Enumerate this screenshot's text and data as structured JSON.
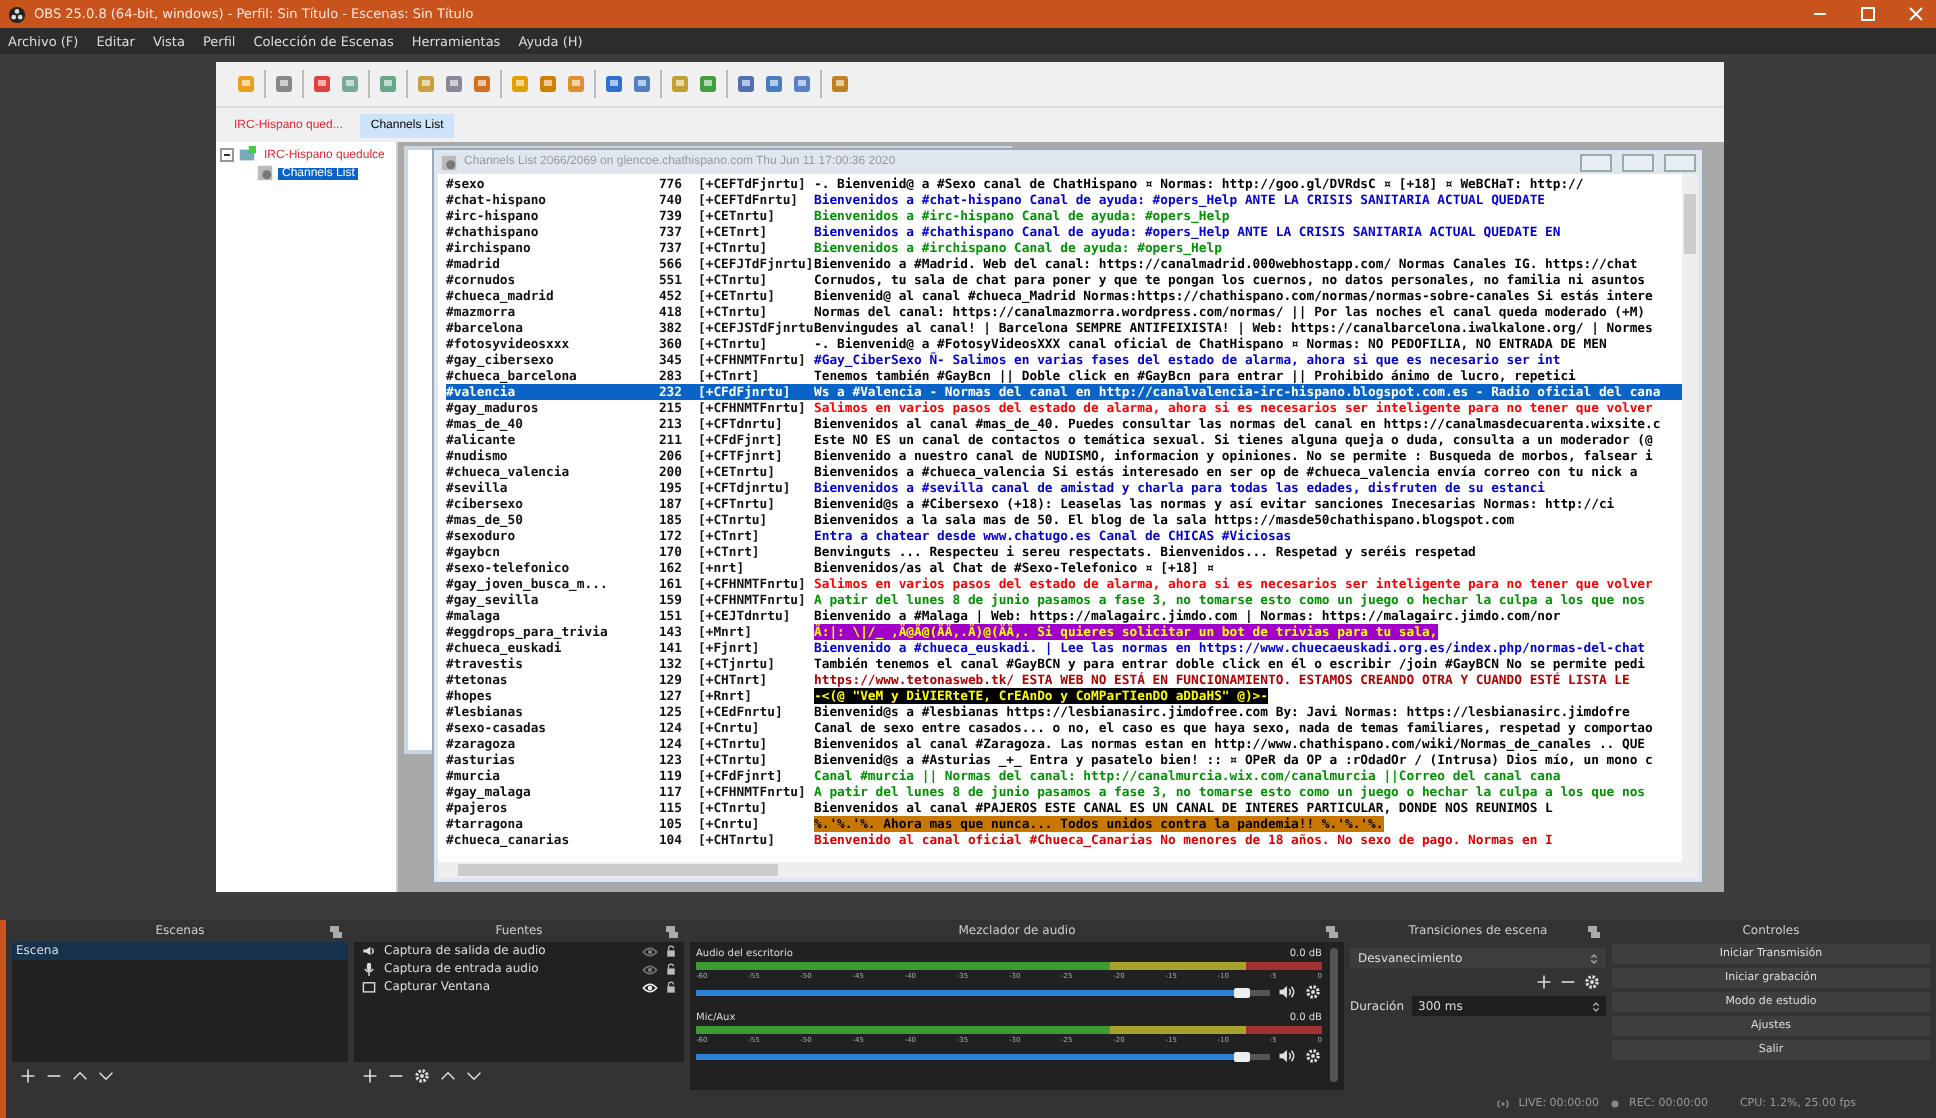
{
  "window": {
    "title": "OBS 25.0.8 (64-bit, windows) - Perfil: Sin Título - Escenas: Sin Título"
  },
  "menu": [
    "Archivo (F)",
    "Editar",
    "Vista",
    "Perfil",
    "Colección de Escenas",
    "Herramientas",
    "Ayuda (H)"
  ],
  "capture": {
    "tabs": [
      {
        "label": "IRC-Hispano qued...",
        "selected": false,
        "color": "#e8262d"
      },
      {
        "label": "Channels List",
        "selected": true,
        "color": "#000000"
      }
    ],
    "tree": [
      {
        "label": "IRC-Hispano quedulce",
        "expanded": true,
        "selected": false,
        "children": [
          {
            "label": "Channels List",
            "selected": true
          }
        ]
      }
    ],
    "channels_window": {
      "title": "Channels List 2066/2069 on glencoe.chathispano.com Thu Jun 11 17:00:36 2020",
      "rows": [
        {
          "name": "#sexo",
          "users": "776",
          "modes": "[+CEFTdFjnrtu]",
          "topic": "-. Bienvenid@ a #Sexo canal de ChatHispano ¤ Normas: http://goo.gl/DVRdsC ¤ [+18] ¤ WeBCHaT: http://",
          "color": "#000000",
          "highlighted": false,
          "selected": false
        },
        {
          "name": "#chat-hispano",
          "users": "740",
          "modes": "[+CEFTdFnrtu]",
          "topic": "Bienvenidos a #chat-hispano Canal de ayuda: #opers_Help ANTE LA CRISIS SANITARIA ACTUAL QUEDATE",
          "color": "#0000d0",
          "highlighted": false,
          "selected": false
        },
        {
          "name": "#irc-hispano",
          "users": "739",
          "modes": "[+CETnrtu]",
          "topic": "Bienvenidos a #irc-hispano Canal de ayuda: #opers_Help",
          "color": "#009300",
          "highlighted": false,
          "selected": false
        },
        {
          "name": "#chathispano",
          "users": "737",
          "modes": "[+CETnrt]",
          "topic": "Bienvenidos a #chathispano Canal de ayuda: #opers_Help ANTE LA CRISIS SANITARIA ACTUAL QUEDATE EN",
          "color": "#0000d0",
          "highlighted": false,
          "selected": false
        },
        {
          "name": "#irchispano",
          "users": "737",
          "modes": "[+CTnrtu]",
          "topic": "Bienvenidos a #irchispano Canal de ayuda: #opers_Help",
          "color": "#009300",
          "highlighted": false,
          "selected": false
        },
        {
          "name": "#madrid",
          "users": "566",
          "modes": "[+CEFJTdFjnrtu]",
          "topic": "Bienvenido a #Madrid. Web del canal: https://canalmadrid.000webhostapp.com/ Normas Canales IG. https://chat",
          "color": "#000000",
          "highlighted": false,
          "selected": false
        },
        {
          "name": "#cornudos",
          "users": "551",
          "modes": "[+CTnrtu]",
          "topic": "Cornudos, tu sala de chat para poner y que te pongan los cuernos, no datos personales, no familia ni asuntos",
          "color": "#000000",
          "highlighted": false,
          "selected": false
        },
        {
          "name": "#chueca_madrid",
          "users": "452",
          "modes": "[+CETnrtu]",
          "topic": "Bienvenid@ al canal #chueca_Madrid Normas:https://chathispano.com/normas/normas-sobre-canales Si estás intere",
          "color": "#000000",
          "highlighted": false,
          "selected": false
        },
        {
          "name": "#mazmorra",
          "users": "418",
          "modes": "[+CTnrtu]",
          "topic": "Normas del canal: https://canalmazmorra.wordpress.com/normas/ || Por las noches el canal queda moderado (+M)",
          "color": "#000000",
          "highlighted": false,
          "selected": false
        },
        {
          "name": "#barcelona",
          "users": "382",
          "modes": "[+CEFJSTdFjnrtu",
          "topic": "Benvingudes al canal! | Barcelona SEMPRE ANTIFEIXISTA! | Web: https://canalbarcelona.iwalkalone.org/ | Normes",
          "color": "#000000",
          "highlighted": false,
          "selected": false
        },
        {
          "name": "#fotosyvideosxxx",
          "users": "360",
          "modes": "[+CTnrtu]",
          "topic": "-. Bienvenid@ a #FotosyVideosXXX canal oficial de ChatHispano ¤ Normas: NO PEDOFILIA, NO ENTRADA DE MEN",
          "color": "#000000",
          "highlighted": false,
          "selected": false
        },
        {
          "name": "#gay_cibersexo",
          "users": "345",
          "modes": "[+CFHNMTFnrtu]",
          "topic": "#Gay_CiberSexo Ñ- Salimos en varias fases del estado de alarma, ahora si que es necesario ser int",
          "color": "#0000d0",
          "highlighted": false,
          "selected": false
        },
        {
          "name": "#chueca_barcelona",
          "users": "283",
          "modes": "[+CTnrt]",
          "topic": "Tenemos también #GayBcn || Doble click en #GayBcn para entrar || Prohibido ánimo de lucro, repetici",
          "color": "#000000",
          "highlighted": false,
          "selected": false
        },
        {
          "name": "#valencia",
          "users": "232",
          "modes": "[+CFdFjnrtu]",
          "topic": "Ws a #Valencia - Normas del canal en http://canalvalencia-irc-hispano.blogspot.com.es - Radio oficial del cana",
          "highlighted": false,
          "selected": true
        },
        {
          "name": "#gay_maduros",
          "users": "215",
          "modes": "[+CFHNMTFnrtu]",
          "topic": "Salimos en varios pasos del estado de alarma, ahora si es necesarios ser inteligente para no tener que volver",
          "color": "#ff0000",
          "highlighted": false,
          "selected": false
        },
        {
          "name": "#mas_de_40",
          "users": "213",
          "modes": "[+CFTdnrtu]",
          "topic": "Bienvenidos al canal #mas_de_40. Puedes consultar las normas del canal en https://canalmasdecuarenta.wixsite.c",
          "color": "#000000",
          "highlighted": false,
          "selected": false
        },
        {
          "name": "#alicante",
          "users": "211",
          "modes": "[+CFdFjnrt]",
          "topic": "Este NO ES un canal de contactos o temática sexual. Si tienes alguna queja o duda, consulta a un moderador (@",
          "color": "#000000",
          "highlighted": false,
          "selected": false
        },
        {
          "name": "#nudismo",
          "users": "206",
          "modes": "[+CFTFjnrt]",
          "topic": "Bienvenido a nuestro canal de NUDISMO, informacion y opiniones. No se permite : Busqueda de morbos, falsear i",
          "color": "#000000",
          "highlighted": false,
          "selected": false
        },
        {
          "name": "#chueca_valencia",
          "users": "200",
          "modes": "[+CETnrtu]",
          "topic": "Bienvenidos a #chueca_valencia Si estás interesado en ser op de #chueca_valencia envía correo con tu nick a",
          "color": "#000000",
          "highlighted": false,
          "selected": false
        },
        {
          "name": "#sevilla",
          "users": "195",
          "modes": "[+CFTdjnrtu]",
          "topic": "Bienvenidos a #sevilla canal de amistad y charla para todas las edades, disfruten de su estanci",
          "color": "#0000d0",
          "highlighted": false,
          "selected": false
        },
        {
          "name": "#cibersexo",
          "users": "187",
          "modes": "[+CFTnrtu]",
          "topic": "Bienvenid@s a #Cibersexo (+18): Leaselas las normas y así evitar sanciones Inecesarias Normas: http://ci",
          "color": "#000000",
          "highlighted": false,
          "selected": false
        },
        {
          "name": "#mas_de_50",
          "users": "185",
          "modes": "[+CTnrtu]",
          "topic": "Bienvenidos a la sala mas de 50. El blog de la sala https://masde50chathispano.blogspot.com",
          "color": "#000000",
          "highlighted": false,
          "selected": false
        },
        {
          "name": "#sexoduro",
          "users": "172",
          "modes": "[+CTnrt]",
          "topic": "Entra a chatear desde www.chatugo.es Canal de CHICAS #Viciosas",
          "color": "#0000d0",
          "highlighted": false,
          "selected": false
        },
        {
          "name": "#gaybcn",
          "users": "170",
          "modes": "[+CTnrt]",
          "topic": "Benvinguts ... Respecteu i sereu respectats. Bienvenidos... Respetad y seréis respetad",
          "color": "#000000",
          "highlighted": false,
          "selected": false
        },
        {
          "name": "#sexo-telefonico",
          "users": "162",
          "modes": "[+nrt]",
          "topic": "Bienvenidos/as al Chat de #Sexo-Telefonico ¤ [+18] ¤",
          "color": "#000000",
          "highlighted": false,
          "selected": false
        },
        {
          "name": "#gay_joven_busca_m...",
          "users": "161",
          "modes": "[+CFHNMTFnrtu]",
          "topic": "Salimos en varios pasos del estado de alarma, ahora si es necesarios ser inteligente para no tener que volver",
          "color": "#ff0000",
          "highlighted": false,
          "selected": false
        },
        {
          "name": "#gay_sevilla",
          "users": "159",
          "modes": "[+CFHNMTFnrtu]",
          "topic": "A patir del lunes 8 de junio pasamos a fase 3, no tomarse esto como un juego o hechar la culpa a los que nos",
          "color": "#009300",
          "highlighted": false,
          "selected": false
        },
        {
          "name": "#malaga",
          "users": "151",
          "modes": "[+CEJTdnrtu]",
          "topic": "Bienvenido a #Malaga | Web: https://malagairc.jimdo.com | Normas: https://malagairc.jimdo.com/nor",
          "color": "#000000",
          "highlighted": false,
          "selected": false
        },
        {
          "name": "#eggdrops_para_trivia",
          "users": "143",
          "modes": "[+Mnrt]",
          "topic": "Ä:|: \\|/_ ,Ä@Ä@(ÄÄ,.Ä)@(ÄÄ,. Si quieres solicitar un bot de trivias para tu sala,",
          "color": "#a000c8",
          "highlighted": true,
          "selected": false
        },
        {
          "name": "#chueca_euskadi",
          "users": "141",
          "modes": "[+Fjnrt]",
          "topic": "Bienvenido a #chueca_euskadi. | Lee las normas en https://www.chuecaeuskadi.org.es/index.php/normas-del-chat",
          "color": "#0000d0",
          "highlighted": false,
          "selected": false
        },
        {
          "name": "#travestis",
          "users": "132",
          "modes": "[+CTjnrtu]",
          "topic": "También tenemos el canal #GayBCN y para entrar doble click en él o escribir /join #GayBCN No se permite pedi",
          "color": "#000000",
          "highlighted": false,
          "selected": false
        },
        {
          "name": "#tetonas",
          "users": "129",
          "modes": "[+CHTnrt]",
          "topic": "https://www.tetonasweb.tk/ ESTA WEB NO ESTÁ EN FUNCIONAMIENTO. ESTAMOS CREANDO OTRA Y CUANDO ESTÉ LISTA LE",
          "color": "#b00000",
          "highlighted": false,
          "selected": false
        },
        {
          "name": "#hopes",
          "users": "127",
          "modes": "[+Rnrt]",
          "topic": "-<(@ \"VeM y DiVIERteTE, CrEAnDo y CoMParTIenDO aDDaHS\" @)>-",
          "color": "#000000",
          "highlighted": true,
          "selected": false
        },
        {
          "name": "#lesbianas",
          "users": "125",
          "modes": "[+CEdFnrtu]",
          "topic": "Bienvenid@s a #lesbianas https://lesbianasirc.jimdofree.com By: Javi Normas: https://lesbianasirc.jimdofre",
          "color": "#000000",
          "highlighted": false,
          "selected": false
        },
        {
          "name": "#sexo-casadas",
          "users": "124",
          "modes": "[+Cnrtu]",
          "topic": "Canal de sexo entre casados... o no, el caso es que haya sexo, nada de temas familiares, respetad y comportao",
          "color": "#000000",
          "highlighted": false,
          "selected": false
        },
        {
          "name": "#zaragoza",
          "users": "124",
          "modes": "[+CTnrtu]",
          "topic": "Bienvenidos al canal #Zaragoza. Las normas estan en http://www.chathispano.com/wiki/Normas_de_canales .. QUE",
          "color": "#000000",
          "highlighted": false,
          "selected": false
        },
        {
          "name": "#asturias",
          "users": "123",
          "modes": "[+CTnrtu]",
          "topic": "Bienvenid@s a #Asturias _+_ Entra y pasatelo bien! :: ¤ OPeR da OP a :rOdadOr / (Intrusa) Dios mío, un mono c",
          "color": "#000000",
          "highlighted": false,
          "selected": false
        },
        {
          "name": "#murcia",
          "users": "119",
          "modes": "[+CFdFjnrt]",
          "topic": "Canal #murcia || Normas del canal: http://canalmurcia.wix.com/canalmurcia ||Correo del canal cana",
          "color": "#009300",
          "highlighted": false,
          "selected": false
        },
        {
          "name": "#gay_malaga",
          "users": "117",
          "modes": "[+CFHNMTFnrtu]",
          "topic": "A patir del lunes 8 de junio pasamos a fase 3, no tomarse esto como un juego o hechar la culpa a los que nos",
          "color": "#009300",
          "highlighted": false,
          "selected": false
        },
        {
          "name": "#pajeros",
          "users": "115",
          "modes": "[+CTnrtu]",
          "topic": "Bienvenidos al canal #PAJEROS ESTE CANAL ES UN CANAL DE INTERES PARTICULAR, DONDE NOS REUNIMOS L",
          "color": "#000000",
          "highlighted": false,
          "selected": false
        },
        {
          "name": "#tarragona",
          "users": "105",
          "modes": "[+Cnrtu]",
          "topic": "%.'%.'%. Ahora mas que nunca... Todos unidos contra la pandemia!! %.'%.'%.",
          "color": "#c87800",
          "highlighted": true,
          "selected": false
        },
        {
          "name": "#chueca_canarias",
          "users": "104",
          "modes": "[+CHTnrtu]",
          "topic": "Bienvenido al canal oficial #Chueca_Canarias No menores de 18 años. No sexo de pago. Normas en I",
          "color": "#e00000",
          "highlighted": false,
          "selected": false
        }
      ]
    }
  },
  "docks": {
    "scenes": {
      "title": "Escenas",
      "items": [
        {
          "label": "Escena",
          "selected": true
        }
      ]
    },
    "sources": {
      "title": "Fuentes",
      "items": [
        {
          "label": "Captura de salida de audio",
          "kind": "speaker",
          "visible": false
        },
        {
          "label": "Captura de entrada audio",
          "kind": "mic",
          "visible": false
        },
        {
          "label": "Capturar Ventana",
          "kind": "window",
          "visible": true
        }
      ]
    },
    "mixer": {
      "title": "Mezclador de audio",
      "channels": [
        {
          "name": "Audio del escritorio",
          "reading": "0.0 dB",
          "level": 0.95,
          "ticks": [
            "-60",
            "-55",
            "-50",
            "-45",
            "-40",
            "-35",
            "-30",
            "-25",
            "-20",
            "-15",
            "-10",
            "-5",
            "0"
          ]
        },
        {
          "name": "Mic/Aux",
          "reading": "0.0 dB",
          "level": 0.95,
          "ticks": [
            "-60",
            "-55",
            "-50",
            "-45",
            "-40",
            "-35",
            "-30",
            "-25",
            "-20",
            "-15",
            "-10",
            "-5",
            "0"
          ]
        }
      ]
    },
    "transitions": {
      "title": "Transiciones de escena",
      "transition": "Desvanecimiento",
      "duration_label": "Duración",
      "duration": "300 ms"
    },
    "controls": {
      "title": "Controles",
      "buttons": [
        "Iniciar Transmisión",
        "Iniciar grabación",
        "Modo de estudio",
        "Ajustes",
        "Salir"
      ]
    }
  },
  "status_bar": {
    "live": "LIVE: 00:00:00",
    "rec": "REC: 00:00:00",
    "cpu": "CPU: 1.2%, 25.00 fps"
  }
}
